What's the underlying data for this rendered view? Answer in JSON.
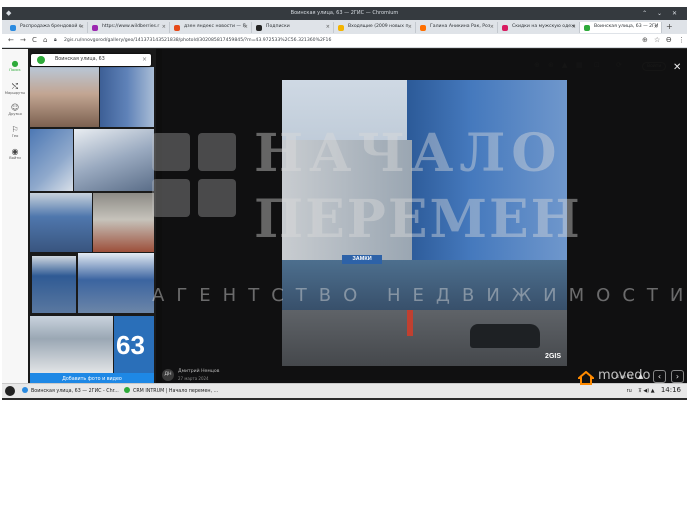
{
  "window": {
    "title": "Воинская улица, 63 — 2ГИС — Chromium",
    "menu_icon": "app-menu-icon",
    "controls": "⌃ ⌄ ✕"
  },
  "tabs": [
    {
      "label": "Распродажа брендовой о",
      "color": "#2b8be0"
    },
    {
      "label": "https://www.wildberries.r",
      "color": "#9c27b0"
    },
    {
      "label": "дзен яндекс новости — Я",
      "color": "#e64a19"
    },
    {
      "label": "Подписки",
      "color": "#222222"
    },
    {
      "label": "Входящие (2009 новых п",
      "color": "#f4b400"
    },
    {
      "label": "Галина Аникина Рак, Роз",
      "color": "#ff6f00"
    },
    {
      "label": "Скидки на мужскую одеж",
      "color": "#d81b60"
    },
    {
      "label": "Воинская улица, 63 — 2ГИ",
      "color": "#2eaa3a",
      "active": true
    }
  ],
  "toolbar": {
    "back": "←",
    "forward": "→",
    "reload": "C",
    "home": "⌂",
    "url": "2gis.ru/nnovgorod/gallery/geo/141373143521838/photoId/302085817459845/?m=43.972533%2C56.321360%2F16",
    "lock_icon": "lock-icon",
    "zoom": "⊕",
    "star": "☆",
    "profile": "Ɵ",
    "menu": "⋮"
  },
  "leftnav": [
    {
      "label": "Поиск",
      "icon": "●"
    },
    {
      "label": "Маршруты",
      "icon": "⤭"
    },
    {
      "label": "Друзья",
      "icon": "☺"
    },
    {
      "label": "Гео",
      "icon": "⚐"
    },
    {
      "label": "Войти",
      "icon": "◉"
    }
  ],
  "search": {
    "value": "Воинская улица, 63",
    "clear": "×"
  },
  "panel": {
    "add_photo_label": "Добавить фото и видео",
    "badge_63": "63"
  },
  "viewer": {
    "author_initials": "ДН",
    "author_name": "Дмитрий Немцов",
    "author_date": "27 марта 2024",
    "counter": "8 из 11",
    "prev": "‹",
    "next": "›",
    "warn": "▲",
    "close": "✕",
    "photo_logo": "2GIS",
    "sign_zamki": "ЗАМКИ"
  },
  "map_top": {
    "icons": [
      "⊕",
      "⊛",
      "▲",
      "▦",
      "⊡",
      "⟳"
    ],
    "login": "Войти"
  },
  "watermark": {
    "line1": "НАЧАЛО",
    "line2": "ПЕРЕМЕН",
    "line3": "АГЕНТСТВО НЕДВИЖИМОСТИ"
  },
  "taskbar": {
    "tasks": [
      {
        "label": "Воинская улица, 63 — 2ГИС - Chr...",
        "color": "#2b8be0"
      },
      {
        "label": "CRM INTRUM | Начало перемен, ...",
        "color": "#2eaa3a"
      }
    ],
    "lang": "ru",
    "tray_icons": "⊼ ◀) ▲",
    "clock": "14:16"
  },
  "brand_overlay": "movedo",
  "colors": {
    "accent": "#2eaa3a",
    "button": "#1e88e5",
    "brand": "#ff8a00"
  }
}
